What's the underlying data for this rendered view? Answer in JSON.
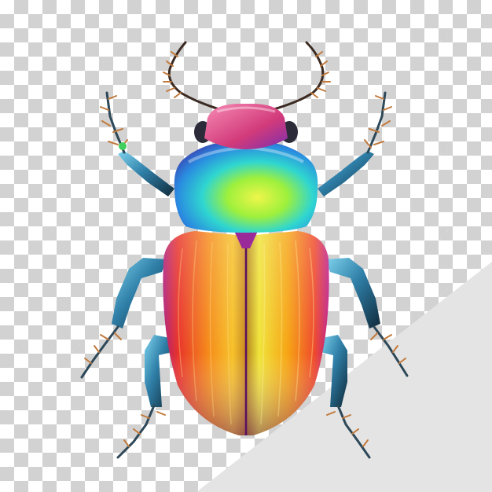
{
  "image": {
    "subject": "iridescent-beetle",
    "background": "transparency-checkerboard",
    "colors": {
      "checker_light": "#ffffff",
      "checker_dark": "#d2d2d2",
      "corner_panel": "#e4e4e4",
      "leg_dark": "#1d3a4c",
      "leg_blue": "#3a8fb5",
      "leg_spine": "#c27a3c",
      "thorax_cyan": "#26c8e6",
      "thorax_green": "#a6ef3b",
      "thorax_blue": "#2d64d2",
      "head_pink": "#e2568c",
      "elytra_orange": "#f6a414",
      "elytra_red": "#e8322a",
      "elytra_magenta": "#c82288",
      "elytra_yellow": "#f0e43a"
    }
  }
}
